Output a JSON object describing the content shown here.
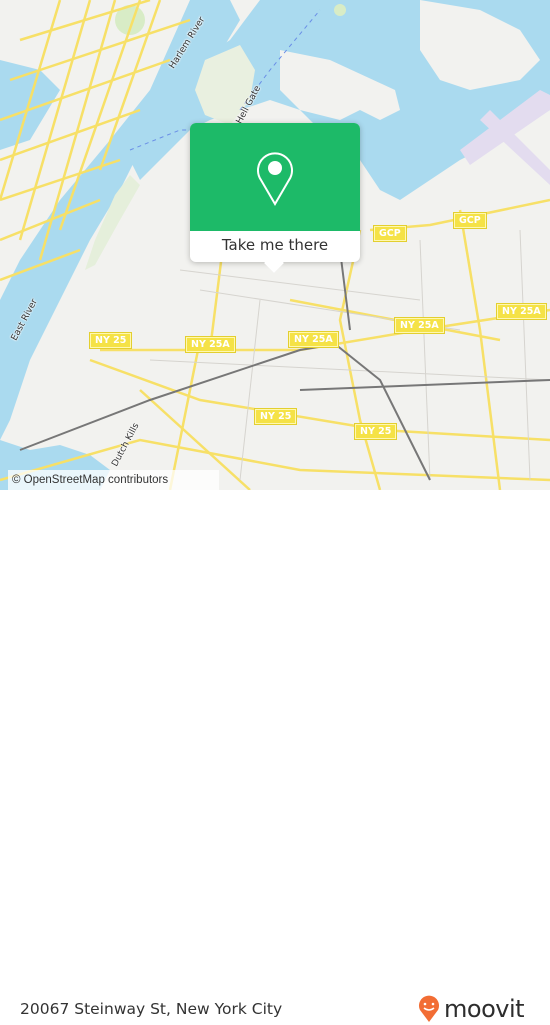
{
  "map": {
    "popup": {
      "icon": "location-pin-icon",
      "button_label": "Take me there",
      "accent_color": "#1dba68"
    },
    "water_labels": [
      "Harlem River",
      "Hell Gate",
      "East River",
      "Dutch Kills"
    ],
    "route_shields": [
      {
        "label": "NY 25"
      },
      {
        "label": "NY 25A"
      },
      {
        "label": "NY 25A"
      },
      {
        "label": "NY 25"
      },
      {
        "label": "NY 25"
      },
      {
        "label": "GCP"
      },
      {
        "label": "GCP"
      },
      {
        "label": "NY 25A"
      },
      {
        "label": "NY 25A"
      }
    ],
    "attribution": "© OpenStreetMap contributors",
    "colors": {
      "water": "#aadaef",
      "land": "#f2f2ef",
      "park": "#d8ecc6",
      "road": "#f7e067",
      "airport": "#e3dcef"
    }
  },
  "footer": {
    "address": "20067 Steinway St, New York City",
    "brand": "moovit",
    "brand_icon": "moovit-smile-pin-icon",
    "brand_color": "#f26d34"
  }
}
